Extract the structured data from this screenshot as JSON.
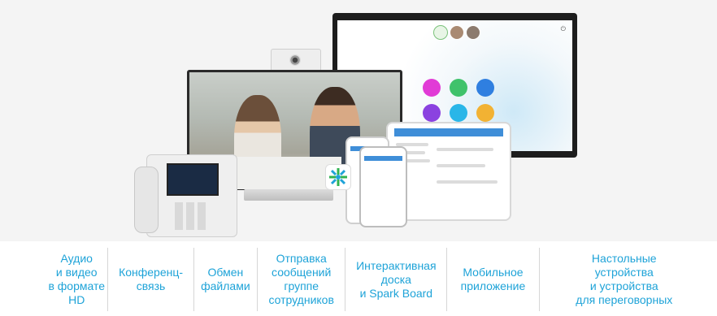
{
  "features": [
    {
      "label": "Аудио\nи видео\nв формате\nHD"
    },
    {
      "label": "Конференц-\nсвязь"
    },
    {
      "label": "Обмен\nфайлами"
    },
    {
      "label": "Отправка\nсообщений\nгруппе\nсотрудников"
    },
    {
      "label": "Интерактивная\nдоска\nи Spark Board"
    },
    {
      "label": "Мобильное\nприложение"
    },
    {
      "label": "Настольные\nустройства\nи устройства\nдля переговорных"
    }
  ],
  "colors": {
    "label_text": "#1ea3d8",
    "divider": "#d6d6d6",
    "board_buttons": [
      "#e13bd6",
      "#3fc26b",
      "#2f7fe0",
      "#8b42e0",
      "#29b6e8",
      "#f2b233"
    ]
  }
}
